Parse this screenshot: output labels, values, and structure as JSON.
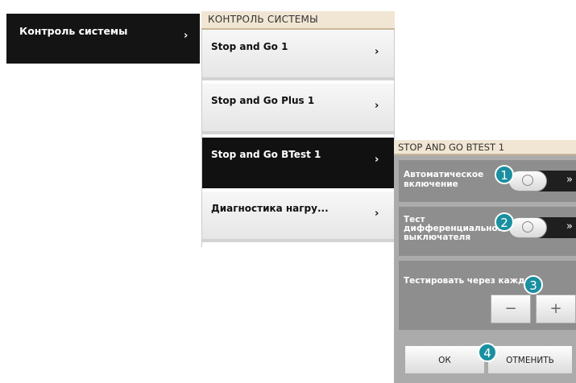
{
  "left_panel": {
    "item_label": "Контроль системы",
    "chevron": "›"
  },
  "middle_panel": {
    "title": "КОНТРОЛЬ СИСТЕМЫ",
    "items": [
      {
        "label": "Stop and Go 1",
        "chevron": "›"
      },
      {
        "label": "Stop and Go Plus 1",
        "chevron": "›"
      },
      {
        "label": "Stop and Go BTest 1",
        "chevron": "›",
        "selected": true
      },
      {
        "label": "Диагностика нагру...",
        "chevron": "›"
      }
    ]
  },
  "right_panel": {
    "title": "STOP AND GO BTEST 1",
    "auto_enable": {
      "label_line1": "Автоматическое",
      "label_line2": "включение",
      "toggle_arrow": "»",
      "knob_icon": "circle-icon"
    },
    "diff_test": {
      "label_line1": "Тест",
      "label_line2": "дифференциального",
      "label_line3": "выключателя",
      "toggle_arrow": "»",
      "knob_icon": "circle-icon"
    },
    "test_interval": {
      "label": "Тестировать через каждые",
      "minus": "−",
      "plus": "+"
    },
    "buttons": {
      "ok": "ОК",
      "cancel": "ОТМЕНИТЬ"
    }
  },
  "callouts": [
    "1",
    "2",
    "3",
    "4"
  ],
  "colors": {
    "accent_badge": "#1a8fa0",
    "header_bg": "#f1e6d3",
    "selected_row": "#111111",
    "panel_bg": "#ababab"
  }
}
